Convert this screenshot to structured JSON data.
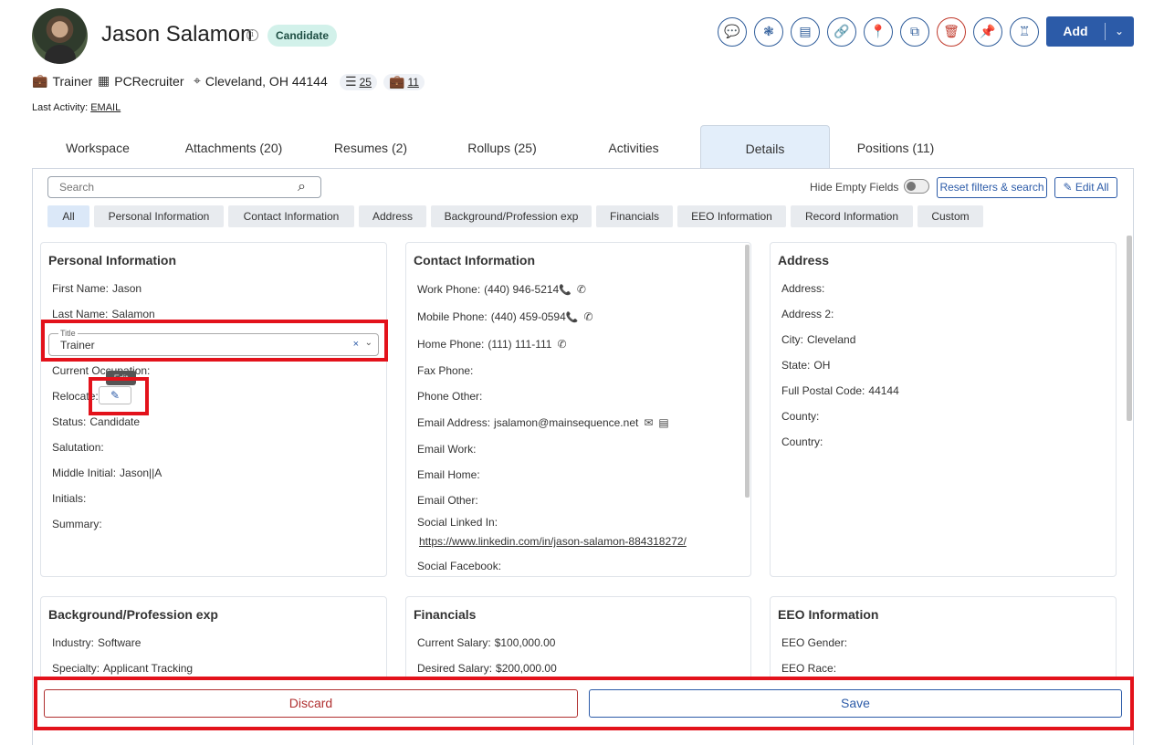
{
  "header": {
    "name": "Jason Salamon",
    "status_badge": "Candidate",
    "add_label": "Add",
    "toolbar_icons": [
      "chat-icon",
      "network-icon",
      "documents-icon",
      "link-icon",
      "location-pin-icon",
      "copy-icon",
      "trash-icon",
      "pin-icon",
      "stamp-icon"
    ]
  },
  "meta": {
    "title": "Trainer",
    "company": "PCRecruiter",
    "location": "Cleveland, OH 44144",
    "rollups_count": "25",
    "positions_count": "11",
    "last_activity_label": "Last Activity:",
    "last_activity_value": "EMAIL"
  },
  "tabs": [
    {
      "label": "Workspace"
    },
    {
      "label": "Attachments (20)"
    },
    {
      "label": "Resumes (2)"
    },
    {
      "label": "Rollups (25)"
    },
    {
      "label": "Activities"
    },
    {
      "label": "Details"
    },
    {
      "label": "Positions (11)"
    }
  ],
  "toolbar": {
    "search_placeholder": "Search",
    "hide_empty_label": "Hide Empty Fields",
    "reset_label": "Reset filters & search",
    "edit_all_label": "Edit All"
  },
  "filters": [
    "All",
    "Personal Information",
    "Contact Information",
    "Address",
    "Background/Profession exp",
    "Financials",
    "EEO Information",
    "Record Information",
    "Custom"
  ],
  "personal": {
    "heading": "Personal Information",
    "first_name_label": "First Name:",
    "first_name": "Jason",
    "last_name_label": "Last Name:",
    "last_name": "Salamon",
    "title_legend": "Title",
    "title_value": "Trainer",
    "current_occupation_label": "Current Occupation:",
    "relocate_label": "Relocate:",
    "tooltip": "Edit",
    "status_label": "Status:",
    "status": "Candidate",
    "salutation_label": "Salutation:",
    "middle_initial_label": "Middle Initial:",
    "middle_initial": "Jason||A",
    "initials_label": "Initials:",
    "summary_label": "Summary:"
  },
  "contact": {
    "heading": "Contact Information",
    "work_phone_label": "Work Phone:",
    "work_phone": "(440) 946-5214",
    "mobile_phone_label": "Mobile Phone:",
    "mobile_phone": "(440) 459-0594",
    "home_phone_label": "Home Phone:",
    "home_phone": "(111) 111-111",
    "fax_label": "Fax Phone:",
    "phone_other_label": "Phone Other:",
    "email_label": "Email Address:",
    "email": "jsalamon@mainsequence.net",
    "email_work_label": "Email Work:",
    "email_home_label": "Email Home:",
    "email_other_label": "Email Other:",
    "linkedin_label": "Social Linked In:",
    "linkedin": "https://www.linkedin.com/in/jason-salamon-884318272/",
    "facebook_label": "Social Facebook:"
  },
  "address": {
    "heading": "Address",
    "address_label": "Address:",
    "address2_label": "Address 2:",
    "city_label": "City:",
    "city": "Cleveland",
    "state_label": "State:",
    "state": "OH",
    "postal_label": "Full Postal Code:",
    "postal": "44144",
    "county_label": "County:",
    "country_label": "Country:"
  },
  "background": {
    "heading": "Background/Profession exp",
    "industry_label": "Industry:",
    "industry": "Software",
    "specialty_label": "Specialty:",
    "specialty": "Applicant Tracking"
  },
  "financials": {
    "heading": "Financials",
    "current_salary_label": "Current Salary:",
    "current_salary": "$100,000.00",
    "desired_salary_label": "Desired Salary:",
    "desired_salary": "$200,000.00"
  },
  "eeo": {
    "heading": "EEO Information",
    "gender_label": "EEO Gender:",
    "race_label": "EEO Race:"
  },
  "actions": {
    "discard_label": "Discard",
    "save_label": "Save"
  },
  "colors": {
    "primary": "#2c5ba8",
    "danger": "#b03030",
    "highlight": "#e3121b",
    "badge_bg": "#d2f1ea"
  }
}
